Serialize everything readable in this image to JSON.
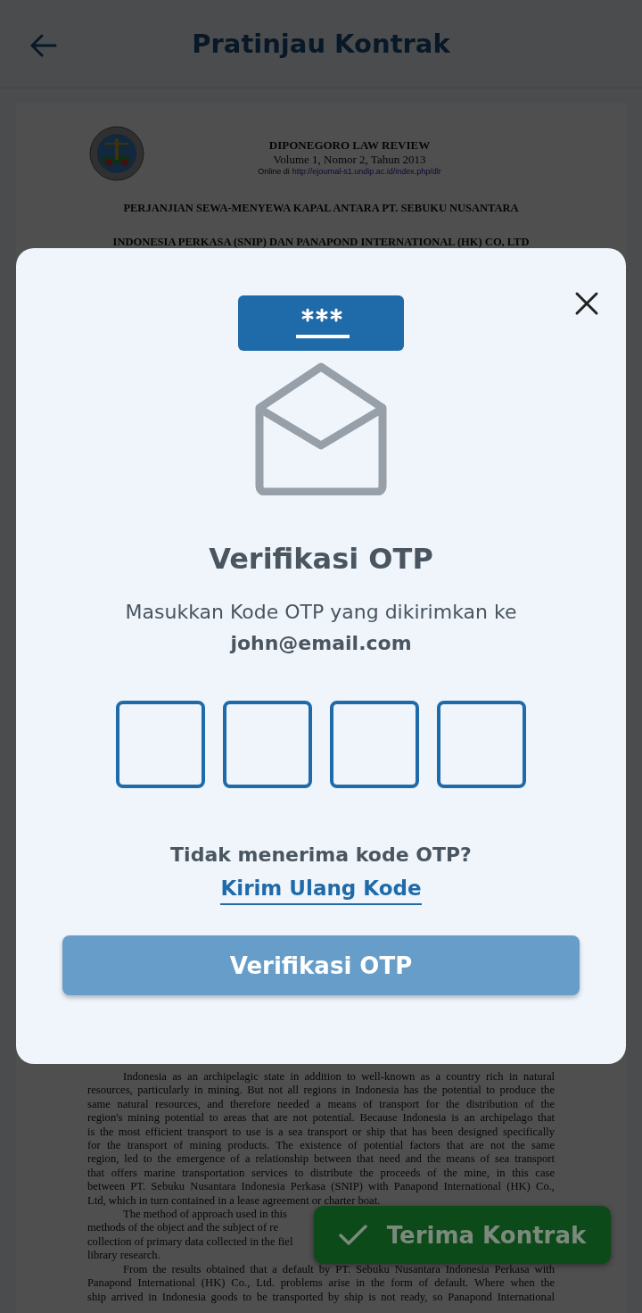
{
  "header": {
    "title": "Pratinjau Kontrak"
  },
  "document": {
    "journal": "DIPONEGORO LAW REVIEW",
    "volume": "Volume 1, Nomor 2, Tahun 2013",
    "online_prefix": "Online di",
    "url": "http://ejournal-s1.undip.ac.id/index.php/dlr",
    "heading": [
      "PERJANJIAN SEWA-MENYEWA KAPAL ANTARA PT. SEBUKU NUSANTARA",
      "INDONESIA PERKASA (SNIP) DAN PANAPOND INTERNATIONAL (HK) CO, LTD"
    ],
    "paragraphs": [
      {
        "lines": [
          {
            "text": "Indonesia as an archipelagic state in addition to well-known as a country rich in natural",
            "justify": true
          },
          {
            "text": "resources, particularly in mining. But not all regions in Indonesia has the potential to produce the",
            "justify": true
          },
          {
            "text": "same natural resources, and therefore needed a means of transport for the distribution of the",
            "justify": true
          },
          {
            "text": "region's mining potential to areas that are not potential. Because Indonesia is an archipelago that",
            "justify": true
          },
          {
            "text": "is the most efficient transport to use is a sea transport or ship that has been designed specifically",
            "justify": true
          },
          {
            "text": "for the transport of mining products. The existence of potential factors that are not the same",
            "justify": true
          },
          {
            "text": "region, led to the emergence of a relationship between that need and the means of sea transport",
            "justify": true
          },
          {
            "text": "that offers marine transportation services to distribute the proceeds of the mine, in this case",
            "justify": true
          },
          {
            "text": "between PT. Sebuku Nusantara Indonesia Perkasa (SNIP) with Panapond International (HK) Co.,",
            "justify": true
          },
          {
            "text": "Ltd, which in turn contained in a lease agreement or charter boat.",
            "justify": false
          }
        ]
      },
      {
        "lines": [
          {
            "text": "The method of approach used in this",
            "justify": false
          },
          {
            "text": "methods of the object and the subject of re",
            "justify": false
          },
          {
            "text": "collection of primary data collected in the fiel",
            "justify": false
          },
          {
            "text": "library research.",
            "justify": false
          }
        ]
      },
      {
        "lines": [
          {
            "text": "From the results obtained that a default by PT. Sebuku Nusantara Indonesia Perkasa with",
            "justify": true
          },
          {
            "text": "Panapond International (HK) Co., Ltd. problems arise in the form of default. Where when the",
            "justify": true
          },
          {
            "text": "ship arrived in Indonesia goods to be transported by ship is not ready, so Panapond International",
            "justify": true
          }
        ]
      }
    ]
  },
  "accept_button": {
    "label": "Terima Kontrak"
  },
  "modal": {
    "title": "Verifikasi OTP",
    "message": "Masukkan Kode OTP yang dikirimkan ke",
    "email": "john@email.com",
    "otp_fields": [
      {
        "kind": "digit"
      },
      {
        "kind": "digit"
      },
      {
        "kind": "digit"
      },
      {
        "kind": "digit"
      }
    ],
    "resend_prompt": "Tidak menerima kode OTP?",
    "resend_link": "Kirim Ulang Kode",
    "submit_button": "Verifikasi OTP"
  }
}
